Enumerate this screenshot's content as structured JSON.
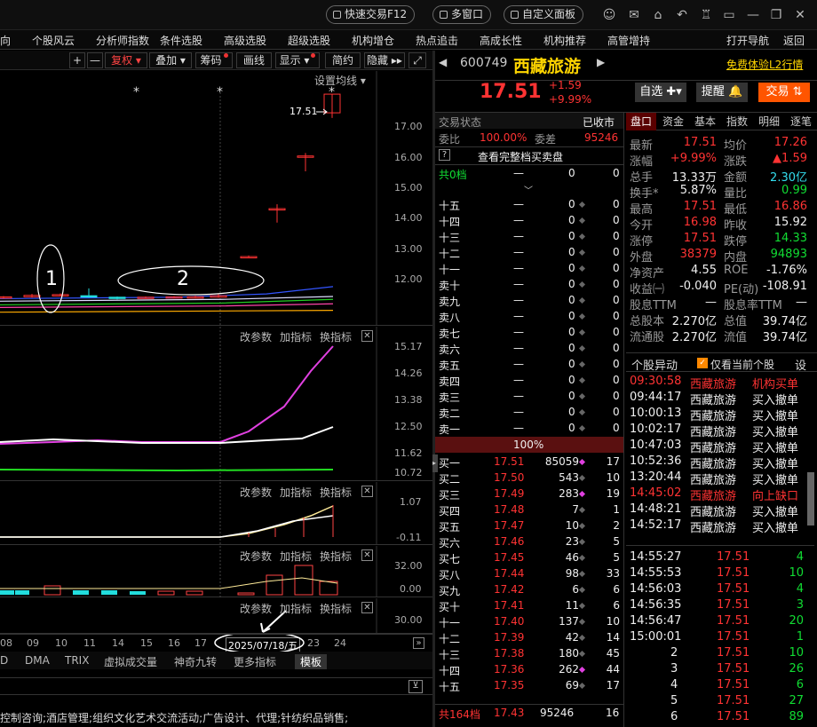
{
  "topbar": {
    "quick_trade": "快速交易F12",
    "multi_window": "多窗口",
    "custom_panel": "自定义面板"
  },
  "menu": [
    "向",
    "个股风云",
    "分析师指数",
    "条件选股",
    "高级选股",
    "超级选股",
    "机构增仓",
    "热点追击",
    "高成长性",
    "机构推荐",
    "高管增持",
    "打开导航",
    "返回"
  ],
  "chart_toolbar": {
    "plus": "+",
    "minus": "—",
    "fuquan": "复权",
    "diejia": "叠加",
    "chouma": "筹码",
    "huaxian": "画线",
    "xianshi": "显示",
    "jianyue": "简约",
    "yincang": "隐藏"
  },
  "main_chart": {
    "ma_setting": "设置均线",
    "last_price_label": "17.51",
    "yaxis": [
      "17.00",
      "16.00",
      "15.00",
      "14.00",
      "13.00",
      "12.00"
    ],
    "annot1": "1",
    "annot2": "2"
  },
  "chart_data": {
    "type": "candlestick",
    "x": [
      "08",
      "09",
      "10",
      "11",
      "14",
      "15",
      "16",
      "17",
      "18",
      "21",
      "22",
      "23",
      "24"
    ],
    "open": [
      11.95,
      11.97,
      12.01,
      12.0,
      11.96,
      11.94,
      11.96,
      11.97,
      11.96,
      13.07,
      14.38,
      15.8,
      17.0
    ],
    "close": [
      11.97,
      12.01,
      12.03,
      11.98,
      11.94,
      11.96,
      11.97,
      11.97,
      12.0,
      13.07,
      14.38,
      15.82,
      17.51
    ],
    "high": [
      11.99,
      12.05,
      12.06,
      12.2,
      11.98,
      11.98,
      11.99,
      12.0,
      12.05,
      13.1,
      14.5,
      15.9,
      17.51
    ],
    "low": [
      11.92,
      11.95,
      11.99,
      11.95,
      11.9,
      11.92,
      11.94,
      11.95,
      11.95,
      13.05,
      14.0,
      15.4,
      16.86
    ],
    "ylim": [
      11.3,
      17.9
    ],
    "highlighted_date": "2025/07/18/五"
  },
  "pane_tools": {
    "gai": "改参数",
    "jia": "加指标",
    "huan": "换指标",
    "close": "✕"
  },
  "pane2": {
    "yaxis": [
      "15.17",
      "14.26",
      "13.38",
      "12.50",
      "11.62",
      "10.72"
    ]
  },
  "pane3": {
    "yaxis": [
      "1.07",
      "-0.11"
    ]
  },
  "pane4": {
    "yaxis": [
      "32.00",
      "0.00"
    ]
  },
  "pane5": {
    "yaxis": [
      "30.00"
    ]
  },
  "xaxis": {
    "labels": [
      "08",
      "09",
      "10",
      "11",
      "14",
      "15",
      "16",
      "17",
      "23",
      "24"
    ],
    "date_box": "2025/07/18/五"
  },
  "tabs": [
    "D",
    "DMA",
    "TRIX",
    "虚拟成交量",
    "神奇九转",
    "更多指标",
    "模板"
  ],
  "bottom_text": "控制咨询;酒店管理;组织文化艺术交流活动;广告设计、代理;针纺织品销售;",
  "stock": {
    "code": "600749",
    "name": "西藏旅游",
    "price": "17.51",
    "change": "+1.59",
    "pct": "+9.99%",
    "l2": "免费体验L2行情",
    "zixuan": "自选",
    "tixing": "提醒",
    "jiaoyi": "交易"
  },
  "order_book": {
    "status_label": "交易状态",
    "status_value": "已收市",
    "weibi_label": "委比",
    "weibi": "100.00%",
    "weicha_label": "委差",
    "weicha": "95246",
    "full_depth": "查看完整档买卖盘",
    "total_sell": "共0档",
    "total_sell_v1": "—",
    "total_sell_v2": "0",
    "total_sell_v3": "0",
    "sells": [
      {
        "l": "十五"
      },
      {
        "l": "十四"
      },
      {
        "l": "十三"
      },
      {
        "l": "十二"
      },
      {
        "l": "十一"
      },
      {
        "l": "卖十"
      },
      {
        "l": "卖九"
      },
      {
        "l": "卖八"
      },
      {
        "l": "卖七"
      },
      {
        "l": "卖六"
      },
      {
        "l": "卖五"
      },
      {
        "l": "卖四"
      },
      {
        "l": "卖三"
      },
      {
        "l": "卖二"
      },
      {
        "l": "卖一"
      }
    ],
    "sell_price": "—",
    "sell_vol": "0",
    "sell_cnt": "0",
    "mid_pct": "100%",
    "buys": [
      {
        "l": "买一",
        "p": "17.51",
        "v": "85059",
        "c": "17"
      },
      {
        "l": "买二",
        "p": "17.50",
        "v": "543",
        "c": "10"
      },
      {
        "l": "买三",
        "p": "17.49",
        "v": "283",
        "c": "19"
      },
      {
        "l": "买四",
        "p": "17.48",
        "v": "7",
        "c": "1"
      },
      {
        "l": "买五",
        "p": "17.47",
        "v": "10",
        "c": "2"
      },
      {
        "l": "买六",
        "p": "17.46",
        "v": "23",
        "c": "5"
      },
      {
        "l": "买七",
        "p": "17.45",
        "v": "46",
        "c": "5"
      },
      {
        "l": "买八",
        "p": "17.44",
        "v": "98",
        "c": "33"
      },
      {
        "l": "买九",
        "p": "17.42",
        "v": "6",
        "c": "6"
      },
      {
        "l": "买十",
        "p": "17.41",
        "v": "11",
        "c": "6"
      },
      {
        "l": "十一",
        "p": "17.40",
        "v": "137",
        "c": "10"
      },
      {
        "l": "十二",
        "p": "17.39",
        "v": "42",
        "c": "14"
      },
      {
        "l": "十三",
        "p": "17.38",
        "v": "180",
        "c": "45"
      },
      {
        "l": "十四",
        "p": "17.36",
        "v": "262",
        "c": "44"
      },
      {
        "l": "十五",
        "p": "17.35",
        "v": "69",
        "c": "17"
      }
    ],
    "total_buy": "共164档",
    "total_buy_price": "17.43",
    "total_buy_vol": "95246",
    "total_buy_cnt": "16"
  },
  "quote_tabs": [
    "盘口",
    "资金",
    "基本",
    "指数",
    "明细",
    "逐笔"
  ],
  "quote": [
    {
      "a": "最新",
      "av": "17.51",
      "ac": "red",
      "b": "均价",
      "bv": "17.26",
      "bc": "red"
    },
    {
      "a": "涨幅",
      "av": "+9.99%",
      "ac": "red",
      "b": "涨跌",
      "bv": "▲1.59",
      "bc": "red"
    },
    {
      "a": "总手",
      "av": "13.33万",
      "ac": "wht",
      "b": "金额",
      "bv": "2.30亿",
      "bc": "cyan"
    },
    {
      "a": "换手*",
      "av": "5.87%",
      "ac": "wht",
      "b": "量比",
      "bv": "0.99",
      "bc": "grn"
    },
    {
      "a": "最高",
      "av": "17.51",
      "ac": "red",
      "b": "最低",
      "bv": "16.86",
      "bc": "red"
    },
    {
      "a": "今开",
      "av": "16.98",
      "ac": "red",
      "b": "昨收",
      "bv": "15.92",
      "bc": "wht"
    },
    {
      "a": "涨停",
      "av": "17.51",
      "ac": "red",
      "b": "跌停",
      "bv": "14.33",
      "bc": "grn"
    },
    {
      "a": "外盘",
      "av": "38379",
      "ac": "red",
      "b": "内盘",
      "bv": "94893",
      "bc": "grn"
    },
    {
      "a": "净资产",
      "av": "4.55",
      "ac": "wht",
      "b": "ROE",
      "bv": "-1.76%",
      "bc": "wht"
    },
    {
      "a": "收益㈠",
      "av": "-0.040",
      "ac": "wht",
      "b": "PE(动)",
      "bv": "-108.91",
      "bc": "wht"
    },
    {
      "a": "股息TTM",
      "av": "—",
      "ac": "wht",
      "b": "股息率TTM",
      "bv": "—",
      "bc": "wht"
    },
    {
      "a": "总股本",
      "av": "2.270亿",
      "ac": "wht",
      "b": "总值",
      "bv": "39.74亿",
      "bc": "wht"
    },
    {
      "a": "流通股",
      "av": "2.270亿",
      "ac": "wht",
      "b": "流值",
      "bv": "39.74亿",
      "bc": "wht"
    }
  ],
  "movement": {
    "title": "个股异动",
    "only_current": "仅看当前个股",
    "settings": "设",
    "rows": [
      {
        "t": "09:30:58",
        "n": "西藏旅游",
        "e": "机构买单",
        "c": "red"
      },
      {
        "t": "09:44:17",
        "n": "西藏旅游",
        "e": "买入撤单",
        "c": "wht"
      },
      {
        "t": "10:00:13",
        "n": "西藏旅游",
        "e": "买入撤单",
        "c": "wht"
      },
      {
        "t": "10:02:17",
        "n": "西藏旅游",
        "e": "买入撤单",
        "c": "wht"
      },
      {
        "t": "10:47:03",
        "n": "西藏旅游",
        "e": "买入撤单",
        "c": "wht"
      },
      {
        "t": "10:52:36",
        "n": "西藏旅游",
        "e": "买入撤单",
        "c": "wht"
      },
      {
        "t": "13:20:44",
        "n": "西藏旅游",
        "e": "买入撤单",
        "c": "wht"
      },
      {
        "t": "14:45:02",
        "n": "西藏旅游",
        "e": "向上缺口",
        "c": "red"
      },
      {
        "t": "14:48:21",
        "n": "西藏旅游",
        "e": "买入撤单",
        "c": "wht"
      },
      {
        "t": "14:52:17",
        "n": "西藏旅游",
        "e": "买入撤单",
        "c": "wht"
      }
    ]
  },
  "ticks": [
    {
      "t": "14:55:27",
      "p": "17.51",
      "v": "4"
    },
    {
      "t": "14:55:53",
      "p": "17.51",
      "v": "10"
    },
    {
      "t": "14:56:03",
      "p": "17.51",
      "v": "4"
    },
    {
      "t": "14:56:35",
      "p": "17.51",
      "v": "3"
    },
    {
      "t": "14:56:47",
      "p": "17.51",
      "v": "20"
    },
    {
      "t": "15:00:01",
      "p": "17.51",
      "v": "1"
    },
    {
      "t": "2",
      "p": "17.51",
      "v": "10"
    },
    {
      "t": "3",
      "p": "17.51",
      "v": "26"
    },
    {
      "t": "4",
      "p": "17.51",
      "v": "6"
    },
    {
      "t": "5",
      "p": "17.51",
      "v": "27"
    },
    {
      "t": "6",
      "p": "17.51",
      "v": "89"
    }
  ]
}
